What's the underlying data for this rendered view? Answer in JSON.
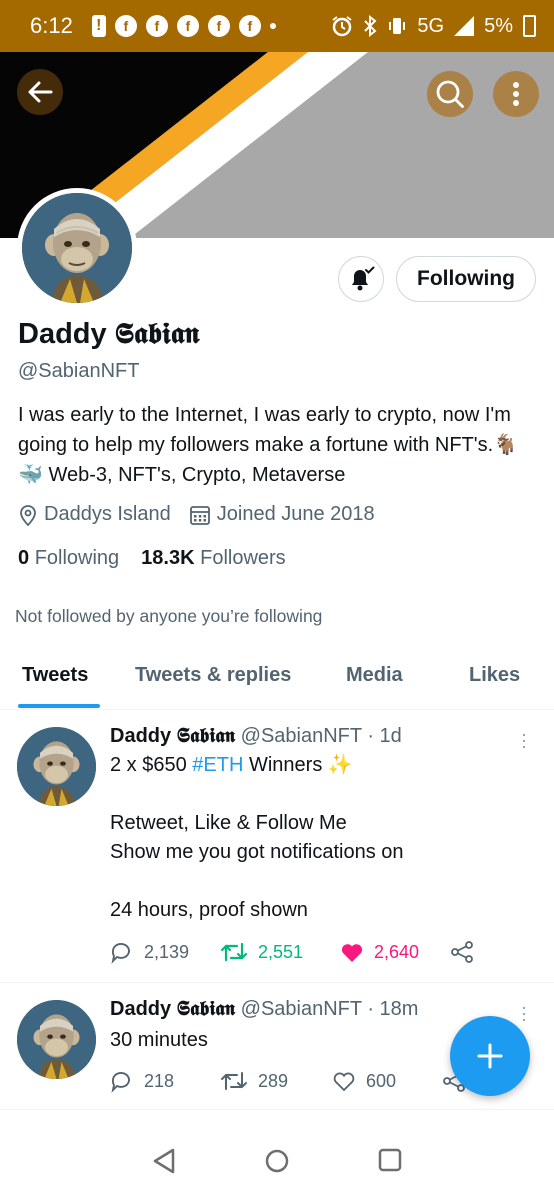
{
  "status_bar": {
    "time": "6:12",
    "alert_glyph": "!",
    "notif_glyph": "f",
    "network": "5G",
    "battery": "5%"
  },
  "header": {
    "back_icon": "arrow-left-icon",
    "search_icon": "search-icon",
    "more_icon": "more-vertical-icon"
  },
  "profile": {
    "name": "Daddy 𝕾𝖆𝖇𝖎𝖆𝖓",
    "handle": "@SabianNFT",
    "bio": "I was early to the Internet, I was early to crypto, now I'm going to help my followers make a fortune with NFT's.🐐🐳 Web-3, NFT's, Crypto, Metaverse",
    "location": "Daddys Island",
    "joined": "Joined June 2018",
    "following_count": "0",
    "following_label": "Following",
    "followers_count": "18.3K",
    "followers_label": "Followers",
    "followed_by_note": "Not followed by anyone you’re following",
    "follow_button": "Following"
  },
  "tabs": [
    "Tweets",
    "Tweets & replies",
    "Media",
    "Likes"
  ],
  "tweets": [
    {
      "name": "Daddy 𝕾𝖆𝖇𝖎𝖆𝖓",
      "handle": "@SabianNFT",
      "time": "· 1d",
      "line1_pre": "2 x $650 ",
      "line1_tag": "#ETH",
      "line1_post": " Winners ✨",
      "line2": "Retweet, Like & Follow Me",
      "line3": "Show me you got notifications on",
      "line4": "24 hours, proof shown",
      "replies": "2,139",
      "retweets": "2,551",
      "likes": "2,640"
    },
    {
      "name": "Daddy 𝕾𝖆𝖇𝖎𝖆𝖓",
      "handle": "@SabianNFT",
      "time": "· 18m",
      "text": "30 minutes",
      "replies": "218",
      "retweets": "289",
      "likes": "600"
    }
  ],
  "colors": {
    "status_bar": "#a46a00",
    "accent": "#1d9bf0",
    "retweet": "#00ba7c",
    "like": "#f91880",
    "banner_stripe": "#f5a623"
  }
}
